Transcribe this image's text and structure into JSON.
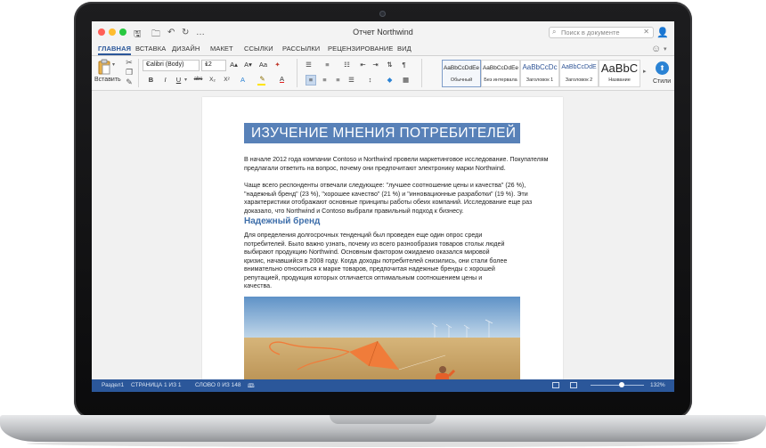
{
  "window": {
    "doc_title": "Отчет Northwind",
    "search_placeholder": "Поиск в документе"
  },
  "tabs": [
    {
      "label": "ГЛАВНАЯ",
      "active": true
    },
    {
      "label": "ВСТАВКА"
    },
    {
      "label": "ДИЗАЙН"
    },
    {
      "label": "МАКЕТ"
    },
    {
      "label": "ССЫЛКИ"
    },
    {
      "label": "РАССЫЛКИ"
    },
    {
      "label": "РЕЦЕНЗИРОВАНИЕ"
    },
    {
      "label": "ВИД"
    }
  ],
  "ribbon": {
    "paste_label": "Вставить",
    "font_name": "Calibri (Body)",
    "font_size": "12",
    "styles": [
      {
        "sample": "AaBbCcDdEe",
        "name": "Обычный"
      },
      {
        "sample": "AaBbCcDdEe",
        "name": "Без интервала"
      },
      {
        "sample": "AaBbCcDc",
        "name": "Заголовок 1"
      },
      {
        "sample": "AaBbCcDdE",
        "name": "Заголовок 2"
      },
      {
        "sample": "AaBbC",
        "name": "Название"
      }
    ],
    "styles_label": "Стили",
    "accent_color": "#2b579a",
    "highlight_color": "#ffe400",
    "font_color": "#e11f1f"
  },
  "document": {
    "heading": "ИЗУЧЕНИЕ МНЕНИЯ ПОТРЕБИТЕЛЕЙ",
    "heading_bg": "#5881b8",
    "paragraph1": "В начале 2012 года компании Contoso и Northwind провели маркетинговое исследование. Покупателям предлагали ответить на вопрос, почему они предпочитают электронику марки Northwind.",
    "paragraph2": "Чаще всего респонденты отвечали следующее: \"лучшее соотношение цены и качества\" (26 %), \"надежный бренд\" (23 %), \"хорошее качество\" (21 %) и \"инновационные разработки\" (19 %). Эти характеристики отображают основные принципы работы обеих компаний. Исследование еще раз доказало, что Northwind и Contoso выбрали правильный подход к бизнесу.",
    "subheading": "Надежный бренд",
    "paragraph3": "Для определения долгосрочных тенденций был проведен еще один опрос среди потребителей. Было важно узнать, почему из всего разнообразия товаров стольк людей выбирают продукцию Northwind. Основным фактором ожидаемо оказался мировой кризис, начавшийся в 2008 году. Когда доходы потребителей снизились, они стали более внимательно относиться к марке товаров, предпочитая надежные бренды с хорошей репутацией, продукция которых отличается оптимальным соотношением цены и качества."
  },
  "statusbar": {
    "section": "Раздел1",
    "page": "СТРАНИЦА 1 ИЗ 1",
    "words": "СЛОВО 0 ИЗ 148",
    "zoom": "132%"
  }
}
